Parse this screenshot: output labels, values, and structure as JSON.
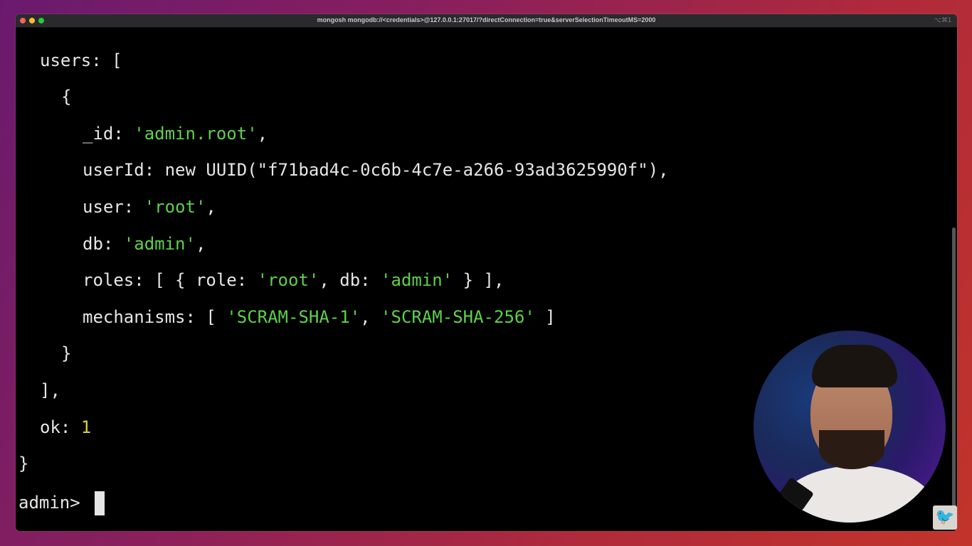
{
  "window": {
    "title": "mongosh mongodb://<credentials>@127.0.0.1:27017/?directConnection=true&serverSelectionTimeoutMS=2000",
    "shortcut": "⌥⌘1"
  },
  "terminal": {
    "l1_key": "users: [",
    "l2": "{",
    "l3_key": "_id: ",
    "l3_val": "'admin.root'",
    "l3_end": ",",
    "l4": "userId: new UUID(\"f71bad4c-0c6b-4c7e-a266-93ad3625990f\"),",
    "l5_key": "user: ",
    "l5_val": "'root'",
    "l5_end": ",",
    "l6_key": "db: ",
    "l6_val": "'admin'",
    "l6_end": ",",
    "l7_a": "roles: [ { role: ",
    "l7_b": "'root'",
    "l7_c": ", db: ",
    "l7_d": "'admin'",
    "l7_e": " } ],",
    "l8_a": "mechanisms: [ ",
    "l8_b": "'SCRAM-SHA-1'",
    "l8_c": ", ",
    "l8_d": "'SCRAM-SHA-256'",
    "l8_e": " ]",
    "l9": "}",
    "l10": "],",
    "l11_key": "ok: ",
    "l11_val": "1",
    "l12": "}",
    "prompt": "admin> "
  },
  "icons": {
    "badge": "bird-icon"
  }
}
